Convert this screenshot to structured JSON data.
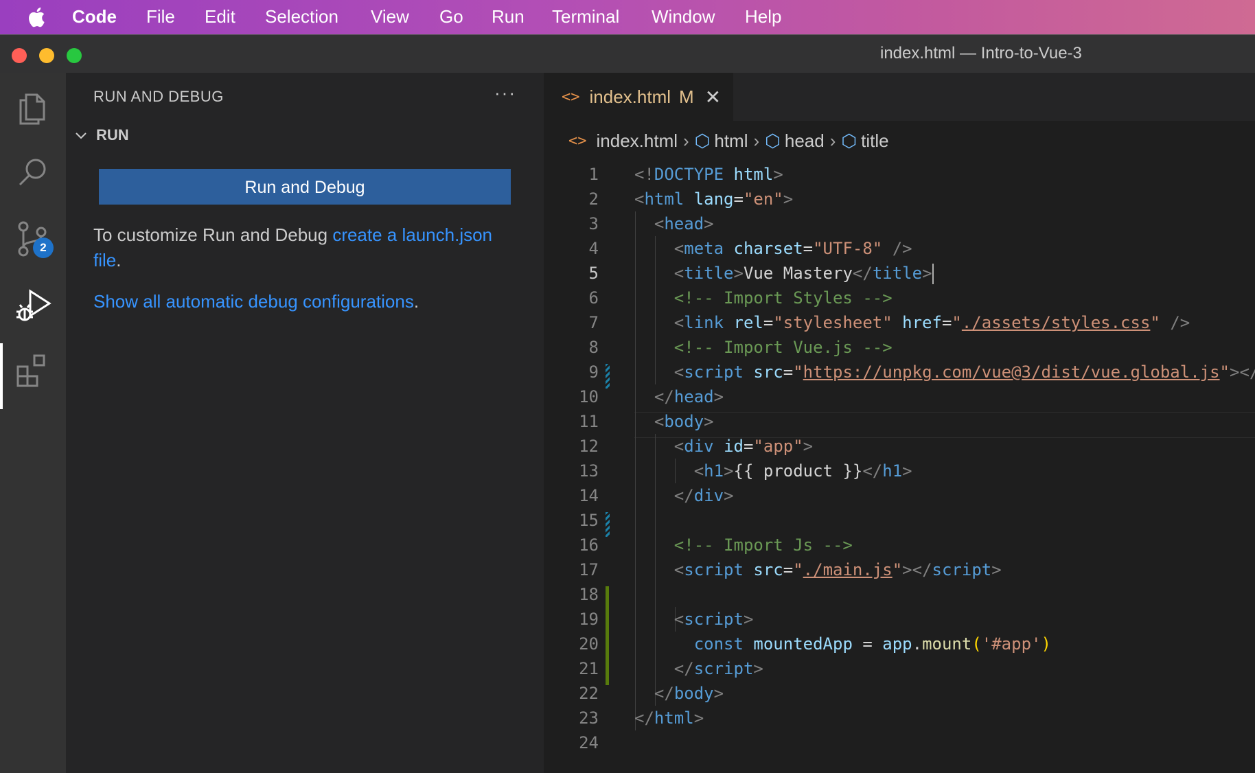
{
  "menubar": {
    "app": "Code",
    "items": [
      "File",
      "Edit",
      "Selection",
      "View",
      "Go",
      "Run",
      "Terminal",
      "Window",
      "Help"
    ]
  },
  "window": {
    "title": "index.html — Intro-to-Vue-3"
  },
  "activity": {
    "scm_badge": "2"
  },
  "sidebar": {
    "title": "RUN AND DEBUG",
    "more": "···",
    "section": "RUN",
    "run_button": "Run and Debug",
    "help_prefix": "To customize Run and Debug ",
    "help_link": "create a launch.json file",
    "help_suffix": ".",
    "show_all_link": "Show all automatic debug configurations",
    "show_all_suffix": "."
  },
  "editor": {
    "tab": {
      "filename": "index.html",
      "status": "M",
      "close": "✕"
    },
    "breadcrumb": [
      "index.html",
      "html",
      "head",
      "title"
    ],
    "current_line": 5,
    "lines": [
      [
        [
          "t-br",
          "<!"
        ],
        [
          "t-tag",
          "DOCTYPE"
        ],
        [
          "t-txt",
          " "
        ],
        [
          "t-attr",
          "html"
        ],
        [
          "t-br",
          ">"
        ]
      ],
      [
        [
          "t-br",
          "<"
        ],
        [
          "t-tag",
          "html"
        ],
        [
          "t-txt",
          " "
        ],
        [
          "t-attr",
          "lang"
        ],
        [
          "t-txt",
          "="
        ],
        [
          "t-str",
          "\"en\""
        ],
        [
          "t-br",
          ">"
        ]
      ],
      [
        [
          "t-txt",
          "  "
        ],
        [
          "t-br",
          "<"
        ],
        [
          "t-tag",
          "head"
        ],
        [
          "t-br",
          ">"
        ]
      ],
      [
        [
          "t-txt",
          "    "
        ],
        [
          "t-br",
          "<"
        ],
        [
          "t-tag",
          "meta"
        ],
        [
          "t-txt",
          " "
        ],
        [
          "t-attr",
          "charset"
        ],
        [
          "t-txt",
          "="
        ],
        [
          "t-str",
          "\"UTF-8\""
        ],
        [
          "t-txt",
          " "
        ],
        [
          "t-br",
          "/>"
        ]
      ],
      [
        [
          "t-txt",
          "    "
        ],
        [
          "t-br",
          "<"
        ],
        [
          "t-tag",
          "title"
        ],
        [
          "t-br",
          ">"
        ],
        [
          "t-txt",
          "Vue Mastery"
        ],
        [
          "t-br",
          "</"
        ],
        [
          "t-tag",
          "title"
        ],
        [
          "t-br",
          ">"
        ],
        [
          "caret",
          ""
        ]
      ],
      [
        [
          "t-txt",
          "    "
        ],
        [
          "t-com",
          "<!-- Import Styles -->"
        ]
      ],
      [
        [
          "t-txt",
          "    "
        ],
        [
          "t-br",
          "<"
        ],
        [
          "t-tag",
          "link"
        ],
        [
          "t-txt",
          " "
        ],
        [
          "t-attr",
          "rel"
        ],
        [
          "t-txt",
          "="
        ],
        [
          "t-str",
          "\"stylesheet\""
        ],
        [
          "t-txt",
          " "
        ],
        [
          "t-attr",
          "href"
        ],
        [
          "t-txt",
          "="
        ],
        [
          "t-str",
          "\""
        ],
        [
          "t-url",
          "./assets/styles.css"
        ],
        [
          "t-str",
          "\""
        ],
        [
          "t-txt",
          " "
        ],
        [
          "t-br",
          "/>"
        ]
      ],
      [
        [
          "t-txt",
          "    "
        ],
        [
          "t-com",
          "<!-- Import Vue.js -->"
        ]
      ],
      [
        [
          "t-txt",
          "    "
        ],
        [
          "t-br",
          "<"
        ],
        [
          "t-tag",
          "script"
        ],
        [
          "t-txt",
          " "
        ],
        [
          "t-attr",
          "src"
        ],
        [
          "t-txt",
          "="
        ],
        [
          "t-str",
          "\""
        ],
        [
          "t-url",
          "https://unpkg.com/vue@3/dist/vue.global.js"
        ],
        [
          "t-str",
          "\""
        ],
        [
          "t-br",
          "></"
        ]
      ],
      [
        [
          "t-txt",
          "  "
        ],
        [
          "t-br",
          "</"
        ],
        [
          "t-tag",
          "head"
        ],
        [
          "t-br",
          ">"
        ]
      ],
      [
        [
          "t-txt",
          "  "
        ],
        [
          "t-br",
          "<"
        ],
        [
          "t-tag",
          "body"
        ],
        [
          "t-br",
          ">"
        ]
      ],
      [
        [
          "t-txt",
          "    "
        ],
        [
          "t-br",
          "<"
        ],
        [
          "t-tag",
          "div"
        ],
        [
          "t-txt",
          " "
        ],
        [
          "t-attr",
          "id"
        ],
        [
          "t-txt",
          "="
        ],
        [
          "t-str",
          "\"app\""
        ],
        [
          "t-br",
          ">"
        ]
      ],
      [
        [
          "t-txt",
          "      "
        ],
        [
          "t-br",
          "<"
        ],
        [
          "t-tag",
          "h1"
        ],
        [
          "t-br",
          ">"
        ],
        [
          "t-txt",
          "{{ product }}"
        ],
        [
          "t-br",
          "</"
        ],
        [
          "t-tag",
          "h1"
        ],
        [
          "t-br",
          ">"
        ]
      ],
      [
        [
          "t-txt",
          "    "
        ],
        [
          "t-br",
          "</"
        ],
        [
          "t-tag",
          "div"
        ],
        [
          "t-br",
          ">"
        ]
      ],
      [],
      [
        [
          "t-txt",
          "    "
        ],
        [
          "t-com",
          "<!-- Import Js -->"
        ]
      ],
      [
        [
          "t-txt",
          "    "
        ],
        [
          "t-br",
          "<"
        ],
        [
          "t-tag",
          "script"
        ],
        [
          "t-txt",
          " "
        ],
        [
          "t-attr",
          "src"
        ],
        [
          "t-txt",
          "="
        ],
        [
          "t-str",
          "\""
        ],
        [
          "t-url",
          "./main.js"
        ],
        [
          "t-str",
          "\""
        ],
        [
          "t-br",
          "></"
        ],
        [
          "t-tag",
          "script"
        ],
        [
          "t-br",
          ">"
        ]
      ],
      [],
      [
        [
          "t-txt",
          "    "
        ],
        [
          "t-br",
          "<"
        ],
        [
          "t-tag",
          "script"
        ],
        [
          "t-br",
          ">"
        ]
      ],
      [
        [
          "t-txt",
          "      "
        ],
        [
          "t-kw",
          "const"
        ],
        [
          "t-txt",
          " "
        ],
        [
          "t-var",
          "mountedApp"
        ],
        [
          "t-txt",
          " = "
        ],
        [
          "t-var",
          "app"
        ],
        [
          "t-txt",
          "."
        ],
        [
          "t-fn",
          "mount"
        ],
        [
          "t-paren",
          "("
        ],
        [
          "t-str",
          "'#app'"
        ],
        [
          "t-paren",
          ")"
        ]
      ],
      [
        [
          "t-txt",
          "    "
        ],
        [
          "t-br",
          "</"
        ],
        [
          "t-tag",
          "script"
        ],
        [
          "t-br",
          ">"
        ]
      ],
      [
        [
          "t-txt",
          "  "
        ],
        [
          "t-br",
          "</"
        ],
        [
          "t-tag",
          "body"
        ],
        [
          "t-br",
          ">"
        ]
      ],
      [
        [
          "t-br",
          "</"
        ],
        [
          "t-tag",
          "html"
        ],
        [
          "t-br",
          ">"
        ]
      ],
      []
    ]
  }
}
